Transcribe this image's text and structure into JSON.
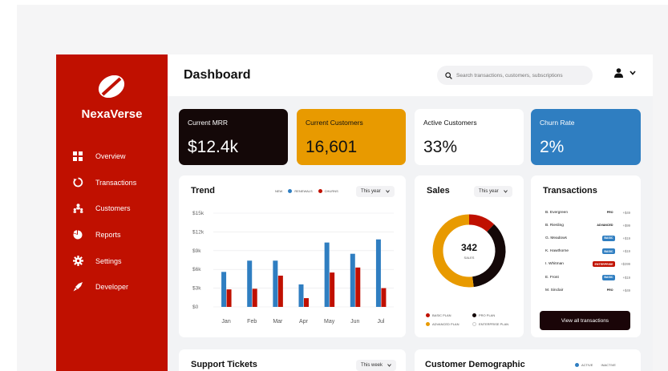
{
  "brand": {
    "name": "NexaVerse",
    "logo_icon": "leaf-slash-logo-icon"
  },
  "sidebar": {
    "items": [
      {
        "label": "Overview",
        "icon": "grid-icon"
      },
      {
        "label": "Transactions",
        "icon": "refresh-icon"
      },
      {
        "label": "Customers",
        "icon": "users-icon"
      },
      {
        "label": "Reports",
        "icon": "pie-chart-icon"
      },
      {
        "label": "Settings",
        "icon": "gear-icon"
      },
      {
        "label": "Developer",
        "icon": "rocket-icon"
      }
    ]
  },
  "header": {
    "title": "Dashboard",
    "search_placeholder": "Search transactions, customers, subscriptions",
    "search_icon": "search-icon",
    "user_icon": "user-icon",
    "menu_icon": "chevron-down-icon"
  },
  "kpis": [
    {
      "title": "Current MRR",
      "value": "$12.4k",
      "bg": "#140808",
      "fg": "#ffffff"
    },
    {
      "title": "Current Customers",
      "value": "16,601",
      "bg": "#e89a00",
      "fg": "#111111"
    },
    {
      "title": "Active Customers",
      "value": "33%",
      "bg": "#ffffff",
      "fg": "#111111"
    },
    {
      "title": "Churn Rate",
      "value": "2%",
      "bg": "#2f7ec1",
      "fg": "#ffffff"
    }
  ],
  "trend": {
    "title": "Trend",
    "filter": "This year",
    "legend": [
      {
        "label": "NEW",
        "color": ""
      },
      {
        "label": "RENEWALS",
        "color": "#2f7ec1"
      },
      {
        "label": "CHURNS",
        "color": "#c01000"
      }
    ]
  },
  "chart_data": {
    "type": "bar",
    "title": "Trend",
    "categories": [
      "Jan",
      "Feb",
      "Mar",
      "Apr",
      "May",
      "Jun",
      "Jul"
    ],
    "series": [
      {
        "name": "RENEWALS",
        "color": "#2f7ec1",
        "values": [
          5600,
          7400,
          7400,
          3600,
          10300,
          8500,
          10800
        ]
      },
      {
        "name": "CHURNS",
        "color": "#c01000",
        "values": [
          2800,
          2900,
          5000,
          1400,
          5500,
          6300,
          3000
        ]
      }
    ],
    "y_ticks": [
      "$0",
      "$3k",
      "$6k",
      "$9k",
      "$12k",
      "$15k"
    ],
    "ylim": [
      0,
      15000
    ],
    "grid": true,
    "legend_position": "top-right"
  },
  "sales": {
    "title": "Sales",
    "filter": "This year",
    "total": "342",
    "total_label": "SALES",
    "segments": [
      {
        "label": "BASIC PLAN",
        "color": "#c01000",
        "value": 12
      },
      {
        "label": "PRO PLAN",
        "color": "#140808",
        "value": 36
      },
      {
        "label": "ADVANCED PLAN",
        "color": "#e89a00",
        "value": 52
      },
      {
        "label": "ENTERPRISE PLAN",
        "color": "#ffffff",
        "value": 0
      }
    ]
  },
  "transactions": {
    "title": "Transactions",
    "rows": [
      {
        "name": "B. Evergreen",
        "plan": "PRO",
        "amount": "+$49",
        "badge_bg": "#ffffff",
        "badge_fg": "#111111"
      },
      {
        "name": "B. Riesling",
        "plan": "ADVANCED",
        "amount": "+$99",
        "badge_bg": "#ffffff",
        "badge_fg": "#111111"
      },
      {
        "name": "G. Meadows",
        "plan": "BASIC",
        "amount": "+$19",
        "badge_bg": "#2f7ec1",
        "badge_fg": "#ffffff"
      },
      {
        "name": "K. Hawthorne",
        "plan": "BASIC",
        "amount": "+$19",
        "badge_bg": "#2f7ec1",
        "badge_fg": "#ffffff"
      },
      {
        "name": "I. Whitman",
        "plan": "ENTERPRISE",
        "amount": "+$399",
        "badge_bg": "#c01000",
        "badge_fg": "#ffffff"
      },
      {
        "name": "E. Frost",
        "plan": "BASIC",
        "amount": "+$19",
        "badge_bg": "#2f7ec1",
        "badge_fg": "#ffffff"
      },
      {
        "name": "M. Sinclair",
        "plan": "PRO",
        "amount": "+$49",
        "badge_bg": "#ffffff",
        "badge_fg": "#111111"
      }
    ],
    "button": "View all transactions"
  },
  "support": {
    "title": "Support Tickets",
    "filter": "This week"
  },
  "demographic": {
    "title": "Customer Demographic",
    "legend": [
      {
        "label": "ACTIVE",
        "color": "#2f7ec1"
      },
      {
        "label": "INACTIVE",
        "color": ""
      }
    ]
  }
}
